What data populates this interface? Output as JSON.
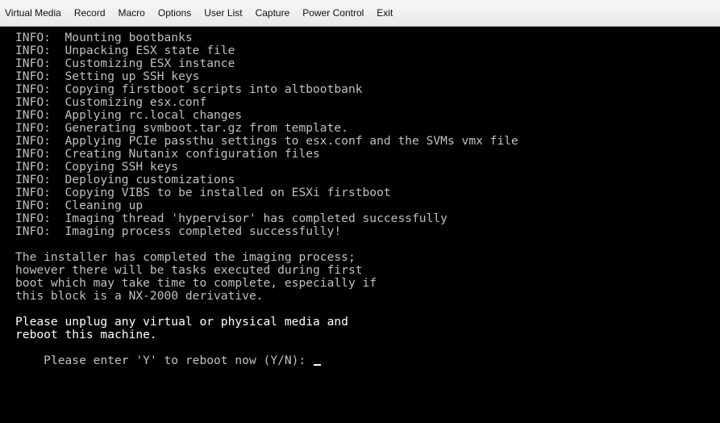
{
  "menu": {
    "items": [
      "Virtual Media",
      "Record",
      "Macro",
      "Options",
      "User List",
      "Capture",
      "Power Control",
      "Exit"
    ]
  },
  "console": {
    "log_lines": [
      "INFO:  Mounting bootbanks",
      "INFO:  Unpacking ESX state file",
      "INFO:  Customizing ESX instance",
      "INFO:  Setting up SSH keys",
      "INFO:  Copying firstboot scripts into altbootbank",
      "INFO:  Customizing esx.conf",
      "INFO:  Applying rc.local changes",
      "INFO:  Generating svmboot.tar.gz from template.",
      "INFO:  Applying PCIe passthu settings to esx.conf and the SVMs vmx file",
      "INFO:  Creating Nutanix configuration files",
      "INFO:  Copying SSH keys",
      "INFO:  Deploying customizations",
      "INFO:  Copying VIBS to be installed on ESXi firstboot",
      "INFO:  Cleaning up",
      "INFO:  Imaging thread 'hypervisor' has completed successfully",
      "INFO:  Imaging process completed successfully!"
    ],
    "message_lines": [
      "The installer has completed the imaging process;",
      "however there will be tasks executed during first",
      "boot which may take time to complete, especially if",
      "this block is a NX-2000 derivative."
    ],
    "warning_lines": [
      "Please unplug any virtual or physical media and",
      "reboot this machine."
    ],
    "prompt": "Please enter 'Y' to reboot now (Y/N): "
  }
}
